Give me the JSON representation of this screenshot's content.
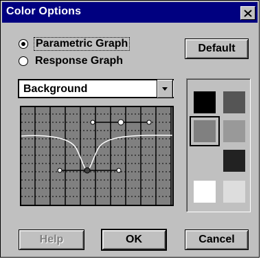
{
  "window": {
    "title": "Color Options",
    "close_symbol": "✕"
  },
  "graph_type": {
    "options": [
      {
        "label": "Parametric Graph",
        "selected": true
      },
      {
        "label": "Response Graph",
        "selected": false
      }
    ]
  },
  "buttons": {
    "default_label": "Default",
    "help_label": "Help",
    "ok_label": "OK",
    "cancel_label": "Cancel"
  },
  "element_select": {
    "value": "Background"
  },
  "swatches": {
    "colors": [
      "#000000",
      "#555555",
      "#808080",
      "#999999",
      "#222222",
      "#ffffff",
      "#dddddd"
    ],
    "selected_index": 2
  },
  "graph_colors": {
    "background": "#808080",
    "grid": "#000000",
    "curve": "#ffffff"
  },
  "icons": {
    "close": "close-icon",
    "dropdown": "chevron-down-icon"
  }
}
